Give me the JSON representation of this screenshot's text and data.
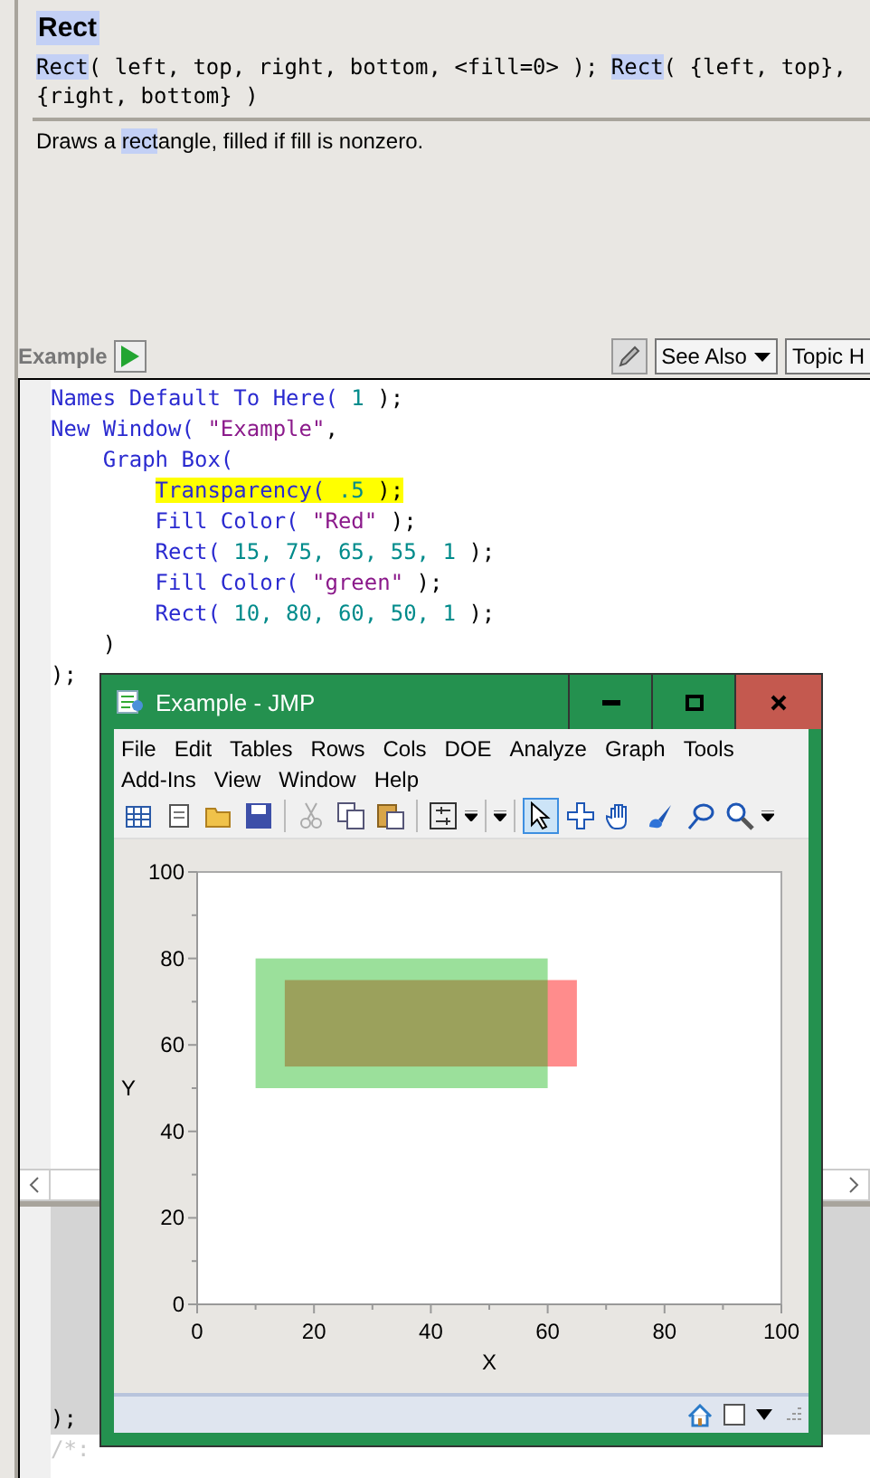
{
  "help": {
    "title": "Rect",
    "syntax": [
      {
        "text": "Rect",
        "highlight": true
      },
      {
        "text": "( left, top, right, bottom, <fill=0> ); ",
        "highlight": false
      },
      {
        "text": "Rect",
        "highlight": true
      },
      {
        "text": "( {left, top}, {right, bottom} )",
        "highlight": false
      }
    ],
    "description": [
      {
        "text": "Draws a ",
        "highlight": false
      },
      {
        "text": "rect",
        "highlight": true
      },
      {
        "text": "angle, filled if fill is nonzero.",
        "highlight": false
      }
    ]
  },
  "example_bar": {
    "label": "Example",
    "see_also": "See Also",
    "topic": "Topic H"
  },
  "code": [
    {
      "highlighted": false,
      "tokens": [
        {
          "text": "Names Default To Here(",
          "kind": "fn"
        },
        {
          "text": " 1 ",
          "kind": "num"
        },
        {
          "text": ");",
          "kind": "punct"
        }
      ]
    },
    {
      "highlighted": false,
      "tokens": [
        {
          "text": "New Window(",
          "kind": "fn"
        },
        {
          "text": " \"Example\"",
          "kind": "str"
        },
        {
          "text": ",",
          "kind": "punct"
        }
      ],
      "children": [
        {
          "highlighted": false,
          "tokens": [
            {
              "text": "Graph Box(",
              "kind": "fn"
            }
          ],
          "children": [
            {
              "highlighted": true,
              "tokens": [
                {
                  "text": "Transparency(",
                  "kind": "fn"
                },
                {
                  "text": " .5 ",
                  "kind": "num"
                },
                {
                  "text": ");",
                  "kind": "punct"
                }
              ]
            },
            {
              "highlighted": false,
              "tokens": [
                {
                  "text": "Fill Color(",
                  "kind": "fn"
                },
                {
                  "text": " \"Red\"",
                  "kind": "str"
                },
                {
                  "text": " );",
                  "kind": "punct"
                }
              ]
            },
            {
              "highlighted": false,
              "tokens": [
                {
                  "text": "Rect(",
                  "kind": "fn"
                },
                {
                  "text": " 15, 75, 65, 55, 1 ",
                  "kind": "num"
                },
                {
                  "text": ");",
                  "kind": "punct"
                }
              ]
            },
            {
              "highlighted": false,
              "tokens": [
                {
                  "text": "Fill Color(",
                  "kind": "fn"
                },
                {
                  "text": " \"green\"",
                  "kind": "str"
                },
                {
                  "text": " );",
                  "kind": "punct"
                }
              ]
            },
            {
              "highlighted": false,
              "tokens": [
                {
                  "text": "Rect(",
                  "kind": "fn"
                },
                {
                  "text": " 10, 80, 60, 50, 1 ",
                  "kind": "num"
                },
                {
                  "text": ");",
                  "kind": "punct"
                }
              ]
            }
          ]
        },
        {
          "highlighted": false,
          "tokens": [
            {
              "text": ")",
              "kind": "punct"
            }
          ]
        }
      ]
    },
    {
      "highlighted": false,
      "tokens": [
        {
          "text": ");",
          "kind": "punct"
        }
      ]
    }
  ],
  "lower_code": [
    {
      "text": ");",
      "kind": "punct"
    },
    {
      "text": "/*:",
      "kind": "comment"
    }
  ],
  "jmp_window": {
    "title": "Example - JMP",
    "menu_rows": [
      [
        "File",
        "Edit",
        "Tables",
        "Rows",
        "Cols",
        "DOE",
        "Analyze",
        "Graph",
        "Tools"
      ],
      [
        "Add-Ins",
        "View",
        "Window",
        "Help"
      ]
    ],
    "tools": [
      {
        "kind": "arrow",
        "selected": true
      },
      {
        "kind": "crosshair",
        "selected": false
      },
      {
        "kind": "hand",
        "selected": false
      },
      {
        "kind": "brush",
        "selected": false
      },
      {
        "kind": "lasso",
        "selected": false
      },
      {
        "kind": "magnifier",
        "selected": false
      }
    ],
    "chart_data": {
      "type": "scatter",
      "xlabel": "X",
      "ylabel": "Y",
      "xlim": [
        0,
        100
      ],
      "ylim": [
        0,
        100
      ],
      "xticks": [
        0,
        20,
        40,
        60,
        80,
        100
      ],
      "yticks": [
        0,
        20,
        40,
        60,
        80,
        100
      ]
    },
    "status_bar": {
      "checked": false
    }
  }
}
